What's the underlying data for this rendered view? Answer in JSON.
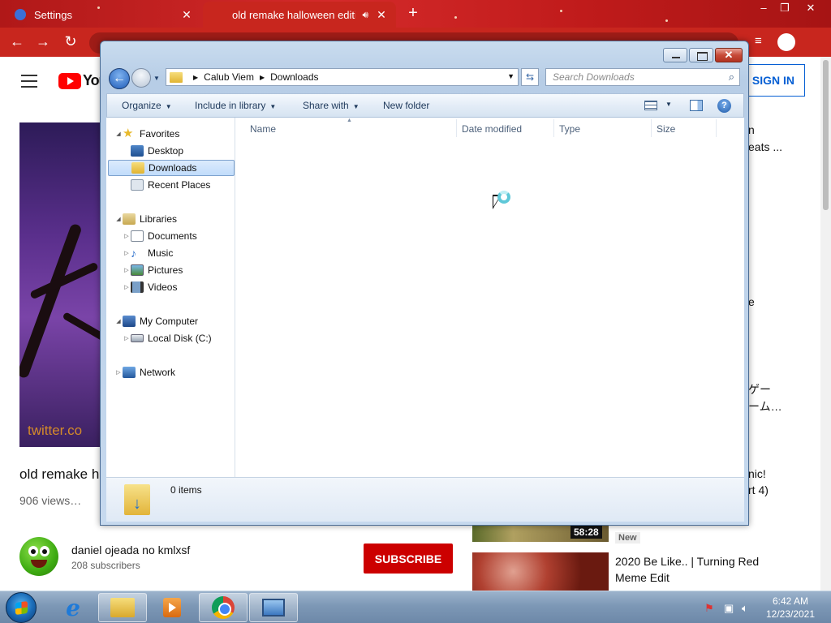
{
  "browser": {
    "tabs": [
      {
        "title": "Settings",
        "active": false
      },
      {
        "title": "old remake halloween editio",
        "active": true
      }
    ],
    "new_tab_icon": "plus-icon",
    "window_controls": {
      "minimize": "–",
      "maximize": "❐",
      "close": "✕"
    }
  },
  "youtube": {
    "logo_text": "You",
    "sign_in": "SIGN IN",
    "player_watermark": "twitter.co",
    "video_title": "old remake h",
    "views": "906 views…",
    "channel_name": "daniel ojeada no kmlxsf",
    "subscribers": "208 subscribers",
    "subscribe": "SUBSCRIBE",
    "sidebar_fragments": [
      "n",
      "eats ...",
      "e",
      "ゲー",
      "ーム…",
      "nic!",
      "rt 4)"
    ],
    "rec_duration": "58:28",
    "rec_new_badge": "New",
    "rec_title": "2020 Be Like.. | Turning Red Meme Edit"
  },
  "explorer": {
    "address": {
      "segments": [
        "Calub Viem",
        "Downloads"
      ]
    },
    "search_placeholder": "Search Downloads",
    "toolbar": {
      "organize": "Organize",
      "include_in_library": "Include in library",
      "share_with": "Share with",
      "new_folder": "New folder"
    },
    "nav": {
      "favorites": "Favorites",
      "desktop": "Desktop",
      "downloads": "Downloads",
      "recent_places": "Recent Places",
      "libraries": "Libraries",
      "documents": "Documents",
      "music": "Music",
      "pictures": "Pictures",
      "videos": "Videos",
      "my_computer": "My Computer",
      "local_disk": "Local Disk (C:)",
      "network": "Network"
    },
    "columns": {
      "name": "Name",
      "date_modified": "Date modified",
      "type": "Type",
      "size": "Size"
    },
    "status": {
      "items": "0 items"
    }
  },
  "taskbar": {
    "time": "6:42 AM",
    "date": "12/23/2021"
  },
  "colors": {
    "chrome_theme_red": "#c8261e",
    "youtube_red": "#cc0000",
    "signin_blue": "#065fd4",
    "win7_taskbar": "#7d98b6"
  }
}
